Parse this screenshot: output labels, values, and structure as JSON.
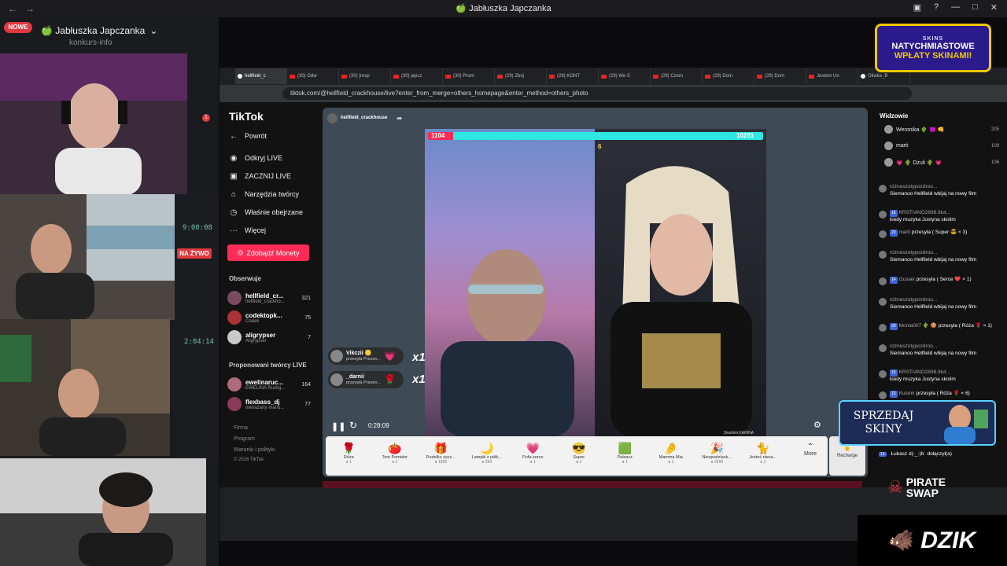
{
  "window": {
    "title": "🍏 Jabłuszka Japczanka",
    "controls": [
      "▣",
      "?",
      "—",
      "□",
      "✕"
    ]
  },
  "discord": {
    "new_badge": "NOWE",
    "server_name": "🍏 Jabłuszka Japczanka",
    "channel": "konkurs-info",
    "live_badge": "NA ŻYWO",
    "timers": [
      "9:00:08",
      "2:04:14"
    ],
    "notification": "1"
  },
  "browser": {
    "tabs": [
      "hellfield_c",
      "(30) Odw",
      "(30) [resp",
      "(30) japcz",
      "(30) Prom",
      "(29) Zbój",
      "(29) KONT",
      "(29) We S",
      "(29) Czem",
      "(29) Dom",
      "(29) Dom",
      "Jestem Un",
      "Oliwka_B"
    ],
    "url": "tiktok.com/@hellfield_crackhouse/live?enter_from_merge=others_homepage&enter_method=others_photo"
  },
  "tiktok": {
    "logo": "TikTok",
    "back": "Powrót",
    "nav": [
      "Odkryj LIVE",
      "ZACZNIJ LIVE",
      "Narzędzia twórcy",
      "Właśnie obejrzane",
      "Więcej"
    ],
    "coins_button": "Zdobądź Monety",
    "following_title": "Obserwuje",
    "following": [
      {
        "name": "hellfield_cr...",
        "sub": "hellfield_crackho...",
        "count": "321"
      },
      {
        "name": "codektopk...",
        "sub": "Codek",
        "count": "75"
      },
      {
        "name": "aligrypser",
        "sub": "Aligrypser",
        "count": "7"
      }
    ],
    "suggested_title": "Proponowani twórcy LIVE",
    "suggested": [
      {
        "name": "ewelinaruc...",
        "sub": "EWELINA Ruckg...",
        "count": "164"
      },
      {
        "name": "flexbass_dj",
        "sub": "nienażarty mariu...",
        "count": "77"
      }
    ],
    "footer": [
      "Firma",
      "Program",
      "Warunki i polityki",
      "© 2026 TikTok"
    ]
  },
  "player": {
    "host": "hellfield_crackhouse",
    "score_left": "1104",
    "score_right": "10281",
    "mid_count": "6",
    "gifts_popups": [
      {
        "user": "Vikczii 🪙",
        "text": "przesyła Prezen...",
        "mult": "x1"
      },
      {
        "user": "_darnii",
        "text": "przesyła Prezen...",
        "mult": "x1"
      }
    ],
    "time": "0:28:09",
    "watermark": "Skarbini.KARINA",
    "gifts": [
      {
        "icon": "🌹",
        "name": "Róża",
        "price": "1"
      },
      {
        "icon": "🍅",
        "name": "Tom Pomidor",
        "price": "1"
      },
      {
        "icon": "🎁",
        "name": "Pudełko życz...",
        "price": "1999"
      },
      {
        "icon": "🌙",
        "name": "Lampki z półk...",
        "price": "299"
      },
      {
        "icon": "💗",
        "name": "Pufa-serce",
        "price": "1"
      },
      {
        "icon": "😎",
        "name": "Super",
        "price": "1"
      },
      {
        "icon": "🟩",
        "name": "Pełzacz",
        "price": "1"
      },
      {
        "icon": "🤌",
        "name": "Mamma Mia",
        "price": "1"
      },
      {
        "icon": "🎉",
        "name": "Niespodziank...",
        "price": "2999"
      },
      {
        "icon": "🐈",
        "name": "Jesteś niesa...",
        "price": "1"
      }
    ],
    "more": "More",
    "recharge": "Recharge"
  },
  "chat": {
    "title": "Widzowie",
    "viewers": [
      {
        "name": "Weronika 🌵 😈 👊",
        "score": "205"
      },
      {
        "name": "marti",
        "score": "109"
      },
      {
        "name": "💗 🌵 Dżuli 🌵 💗",
        "score": "106"
      }
    ],
    "messages": [
      {
        "user": "różneszotypozdroo...",
        "badge": "",
        "text": "Siemanoo Hellfield wbijaj na nowy film"
      },
      {
        "user": "KRSTIANO2898.9lut...",
        "badge": "16",
        "text": "kiedy muzyka Justyna skolim"
      },
      {
        "user": "marti",
        "badge": "20",
        "text": "przesyła ( Super 😎 × 3)"
      },
      {
        "user": "różneszotypozdroo...",
        "badge": "",
        "text": "Siemanoo Hellfield wbijaj na nowy film"
      },
      {
        "user": "Gusiak",
        "badge": "14",
        "text": "przesyła ( Serce ❤️ × 1)"
      },
      {
        "user": "różneszotypozdroo...",
        "badge": "",
        "text": "Siemanoo Hellfield wbijaj na nowy film"
      },
      {
        "user": "Monia007 🌵 🍪",
        "badge": "30",
        "text": "przesyła ( Róża 🌹 × 1)"
      },
      {
        "user": "różneszotypozdroo...",
        "badge": "",
        "text": "Siemanoo Hellfield wbijaj na nowy film"
      },
      {
        "user": "KRSTIANO2898.9lut...",
        "badge": "16",
        "text": "kiedy muzyka Justyna skolim"
      },
      {
        "user": "Kuśmir",
        "badge": "13",
        "text": "przesyła ( Róża 🌹 × 6)"
      }
    ],
    "join": {
      "badge": "13",
      "user": "Łukasz d(-_-)b",
      "text": "dołączył(a)"
    }
  },
  "overlays": {
    "top_brand": "SKINS",
    "top_line1": "NATYCHMIASTOWE",
    "top_line2": "WPŁATY SKINAMI!",
    "sell_line1": "SPRZEDAJ",
    "sell_line2": "SKINY",
    "pirate_line1": "PIRATE",
    "pirate_line2": "SWAP",
    "dzik": "DZIK"
  }
}
